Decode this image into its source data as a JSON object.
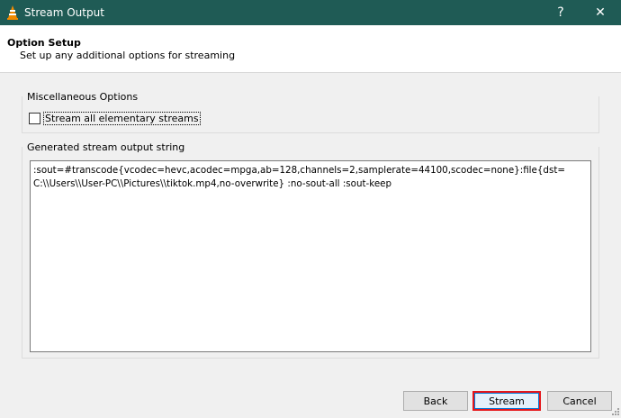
{
  "window": {
    "title": "Stream Output",
    "help_label": "?",
    "close_label": "✕",
    "titlebar_color": "#1f5b55"
  },
  "header": {
    "title": "Option Setup",
    "subtitle": "Set up any additional options for streaming"
  },
  "misc_options": {
    "group_title": "Miscellaneous Options",
    "stream_all_label": "Stream all elementary streams",
    "stream_all_checked": false
  },
  "output_string": {
    "group_title": "Generated stream output string",
    "value": ":sout=#transcode{vcodec=hevc,acodec=mpga,ab=128,channels=2,samplerate=44100,scodec=none}:file{dst=C:\\\\Users\\\\User-PC\\\\Pictures\\\\tiktok.mp4,no-overwrite} :no-sout-all :sout-keep"
  },
  "buttons": {
    "back": "Back",
    "stream": "Stream",
    "cancel": "Cancel",
    "highlight_color": "#e5161a"
  },
  "icons": {
    "app": "vlc-cone-icon",
    "help": "help-icon",
    "close": "close-icon"
  }
}
